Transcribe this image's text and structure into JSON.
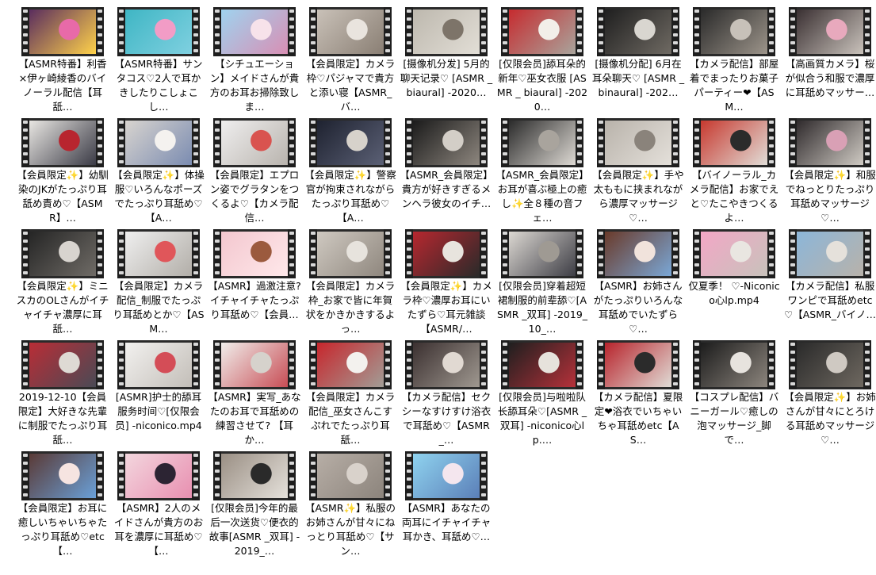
{
  "files": [
    {
      "name": "【ASMR特番】利香×伊ヶ崎綾香のバイノーラル配信【耳舐…",
      "colors": [
        "#5a2d5e",
        "#e86aa8",
        "#ffd24a"
      ]
    },
    {
      "name": "【ASMR特番】サンタコス♡2人で耳かきしたりこしょこし…",
      "colors": [
        "#3fb6c4",
        "#f29cc6",
        "#7fd0e0"
      ]
    },
    {
      "name": "【シチュエーション】メイドさんが貴方のお耳お掃除致しま…",
      "colors": [
        "#9fd3ef",
        "#f7e2ea",
        "#d88fb4"
      ]
    },
    {
      "name": "【会員限定】カメラ枠♡パジャマで貴方と添い寝【ASMR_バ…",
      "colors": [
        "#c9c1b8",
        "#e9e4de",
        "#8a7f74"
      ]
    },
    {
      "name": "[摄像机分发] 5月的聊天记录♡ [ASMR _ biaural] -2020…",
      "colors": [
        "#bdb8ae",
        "#7d7469",
        "#e2ded6"
      ]
    },
    {
      "name": "[仅限会员]舔耳朵的新年♡巫女衣服 [ASMR _ biaural] -2020…",
      "colors": [
        "#c62b2f",
        "#f2efe9",
        "#a9a49c"
      ]
    },
    {
      "name": "[摄像机分配] 6月在耳朵聊天♡ [ASMR _ binaural] -202…",
      "colors": [
        "#1f1f1f",
        "#d9d6d0",
        "#6f6a63"
      ]
    },
    {
      "name": "【カメラ配信】部屋着でまったりお菓子パーティー❤【ASM…",
      "colors": [
        "#2a2a2a",
        "#c7c1b9",
        "#9c948a"
      ]
    },
    {
      "name": "【高画質カメラ】桜が似合う和服で濃厚に耳舐めマッサー…",
      "colors": [
        "#3a3032",
        "#e8a9bd",
        "#c9c2bb"
      ]
    },
    {
      "name": "【会員限定✨】幼馴染のJKがたっぷり耳舐め責め♡【ASMR】…",
      "colors": [
        "#e8e6e2",
        "#b8252f",
        "#3b3b46"
      ]
    },
    {
      "name": "【会員限定✨】体操服♡いろんなポーズでたっぷり耳舐め♡【A…",
      "colors": [
        "#d8d4cf",
        "#f4f2ef",
        "#7b8cb1"
      ]
    },
    {
      "name": "【会員限定】エプロン姿でグラタンをつくるよ♡【カメラ配信…",
      "colors": [
        "#efeeee",
        "#d9534f",
        "#b9b4ae"
      ]
    },
    {
      "name": "【会員限定✨】警察官が拘束されながらたっぷり耳舐め♡【A…",
      "colors": [
        "#1e2230",
        "#d7d2cb",
        "#5b6075"
      ]
    },
    {
      "name": "【ASMR_会員限定】貴方が好きすぎるメンヘラ彼女のイチ…",
      "colors": [
        "#1b1b1b",
        "#d3cec7",
        "#8d867e"
      ]
    },
    {
      "name": "【ASMR_会員限定】お耳が喜ぶ極上の癒し✨全８種の音フェ…",
      "colors": [
        "#2b2b2b",
        "#a9a49d",
        "#ddd9d3"
      ]
    },
    {
      "name": "【会員限定✨】手や太ももに挟まれながら濃厚マッサージ♡…",
      "colors": [
        "#b9b3ab",
        "#8a837b",
        "#e4e0da"
      ]
    },
    {
      "name": "【バイノーラル_カメラ配信】お家でえと♡たこやきつくるよ…",
      "colors": [
        "#c7392f",
        "#2b2b2b",
        "#e1ddd7"
      ]
    },
    {
      "name": "【会員限定✨】和服でねっとりたっぷり耳舐めマッサージ♡…",
      "colors": [
        "#2f2a2c",
        "#d9a0b5",
        "#cfcac3"
      ]
    },
    {
      "name": "【会員限定✨】ミニスカのOLさんがイチャイチャ濃厚に耳舐…",
      "colors": [
        "#252525",
        "#d8d4cf",
        "#6f6b66"
      ]
    },
    {
      "name": "【会員限定】カメラ配信_制服でたっぷり耳舐めとか♡【ASM…",
      "colors": [
        "#efefef",
        "#e0565a",
        "#b2aea8"
      ]
    },
    {
      "name": "【ASMR】過激注意? イチャイチャたっぷり耳舐め♡【会員…",
      "colors": [
        "#f3c7cf",
        "#9b5a3e",
        "#ffe8ea"
      ]
    },
    {
      "name": "【会員限定】カメラ枠_お家で皆に年賀状をかきかきするよっ…",
      "colors": [
        "#cfc9c1",
        "#e7e3dd",
        "#8f877e"
      ]
    },
    {
      "name": "【会員限定✨】カメラ枠♡濃厚お耳にいたずら♡耳元雑談【ASMR/…",
      "colors": [
        "#b7272f",
        "#e8e4de",
        "#2a2a2a"
      ]
    },
    {
      "name": "[仅限会员]穿着超短裙制服的前辈舔♡[ASMR _双耳] -2019_10_…",
      "colors": [
        "#dcd8d2",
        "#9f9a93",
        "#3d3d45"
      ]
    },
    {
      "name": "【ASMR】お姉さんがたっぷりいろんな耳舐めでいたずら♡…",
      "colors": [
        "#6a3a2a",
        "#f1e3dc",
        "#7aa7d6"
      ]
    },
    {
      "name": "仅夏季！ ♡-Niconico心lp.mp4",
      "colors": [
        "#f3a7c6",
        "#e9e6e1",
        "#c8c2bb"
      ]
    },
    {
      "name": "【カメラ配信】私服ワンピで耳舐めetc♡【ASMR_バイノ…",
      "colors": [
        "#8cb6d9",
        "#e5e1db",
        "#b8b2aa"
      ]
    },
    {
      "name": "2019-12-10【会員限定】大好きな先輩に制服でたっぷり耳舐…",
      "colors": [
        "#b92d36",
        "#dedad4",
        "#4a4a55"
      ]
    },
    {
      "name": "[ASMR]护士的舔耳服务时间♡[仅限会员] -niconico.mp4",
      "colors": [
        "#f2f1ef",
        "#d44d57",
        "#c3beb8"
      ]
    },
    {
      "name": "【ASMR】実写_あなたのお耳で耳舐めの練習させて? 【耳か…",
      "colors": [
        "#f0eeeb",
        "#d6d2cc",
        "#c84d55"
      ]
    },
    {
      "name": "【会員限定】カメラ配信_巫女さんこすぷれでたっぷり耳舐…",
      "colors": [
        "#c7262c",
        "#f3f1ee",
        "#a29d96"
      ]
    },
    {
      "name": "【カメラ配信】セクシーなすけすけ浴衣で耳舐め♡【ASMR_…",
      "colors": [
        "#3b3030",
        "#e1d9d2",
        "#9f9890"
      ]
    },
    {
      "name": "[仅限会员]与啦啦队长舔耳朵♡[ASMR _双耳] -niconico心lp.…",
      "colors": [
        "#1f1f1f",
        "#e6e2dc",
        "#b5313a"
      ]
    },
    {
      "name": "【カメラ配信】夏限定❤浴衣でいちゃいちゃ耳舐めetc【AS…",
      "colors": [
        "#b8242c",
        "#2b2b2b",
        "#e0dcd6"
      ]
    },
    {
      "name": "【コスプレ配信】バニーガール♡癒しの泡マッサージ_脚で…",
      "colors": [
        "#1c1c1c",
        "#e7e3de",
        "#8c857d"
      ]
    },
    {
      "name": "【会員限定✨】お姉さんが甘々にとろける耳舐めマッサージ♡…",
      "colors": [
        "#2a2a2a",
        "#cfc9c2",
        "#6e6860"
      ]
    },
    {
      "name": "【会員限定】お耳に癒しいちゃいちゃたっぷり耳舐め♡etc【…",
      "colors": [
        "#5a3a36",
        "#f6e4e1",
        "#6aa0d8"
      ]
    },
    {
      "name": "【ASMR】2人のメイドさんが貴方のお耳を濃厚に耳舐め♡【…",
      "colors": [
        "#f3d6de",
        "#2c2433",
        "#e88fb0"
      ]
    },
    {
      "name": "[仅限会员]今年的最后一次送货♡便衣的故事[ASMR _双耳] -2019_…",
      "colors": [
        "#9a8f84",
        "#2a2a2a",
        "#e5e1db"
      ]
    },
    {
      "name": "【ASMR✨】私服のお姉さんが甘々にねっとり耳舐め♡【サン…",
      "colors": [
        "#b7aea6",
        "#d9d2cb",
        "#8c847c"
      ]
    },
    {
      "name": "【ASMR】あなたの両耳にイチャイチャ耳かき、耳舐め♡…",
      "colors": [
        "#8fd3ef",
        "#f4e6ee",
        "#5b7fb8"
      ]
    }
  ]
}
